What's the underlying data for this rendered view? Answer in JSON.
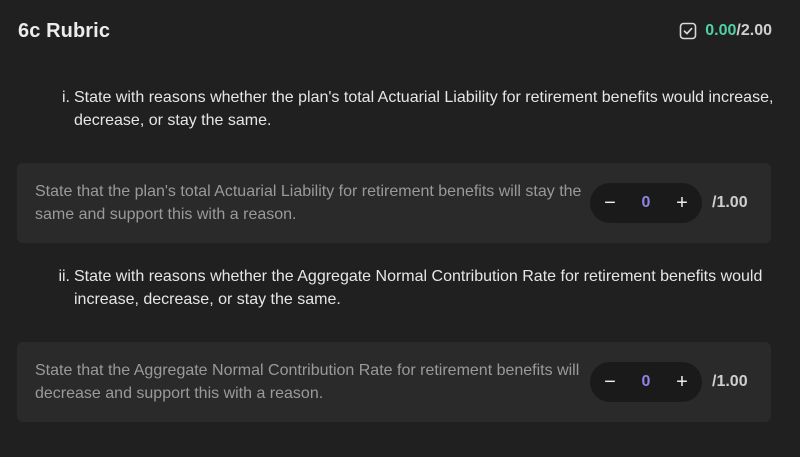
{
  "rubric": {
    "title": "6c Rubric",
    "score_earned": "0.00",
    "score_separator": "/",
    "score_total": "2.00",
    "earned_color": "#4fd1a5",
    "score_icon": "checkbox-icon"
  },
  "questions": [
    {
      "number": "i.",
      "text": "State with reasons whether the plan's total Actuarial Liability for retirement benefits would increase, decrease, or stay the same.",
      "criterion": {
        "text": "State that the plan's total Actuarial Liability for retirement benefits will stay the same and support this with a reason.",
        "minus_label": "−",
        "value": "0",
        "plus_label": "+",
        "max_points": "/1.00"
      }
    },
    {
      "number": "ii.",
      "text": "State with reasons whether the Aggregate Normal Contribution Rate for retirement benefits would increase, decrease, or stay the same.",
      "criterion": {
        "text": "State that the Aggregate Normal Contribution Rate for retirement benefits will decrease and support this with a reason.",
        "minus_label": "−",
        "value": "0",
        "plus_label": "+",
        "max_points": "/1.00"
      }
    }
  ]
}
